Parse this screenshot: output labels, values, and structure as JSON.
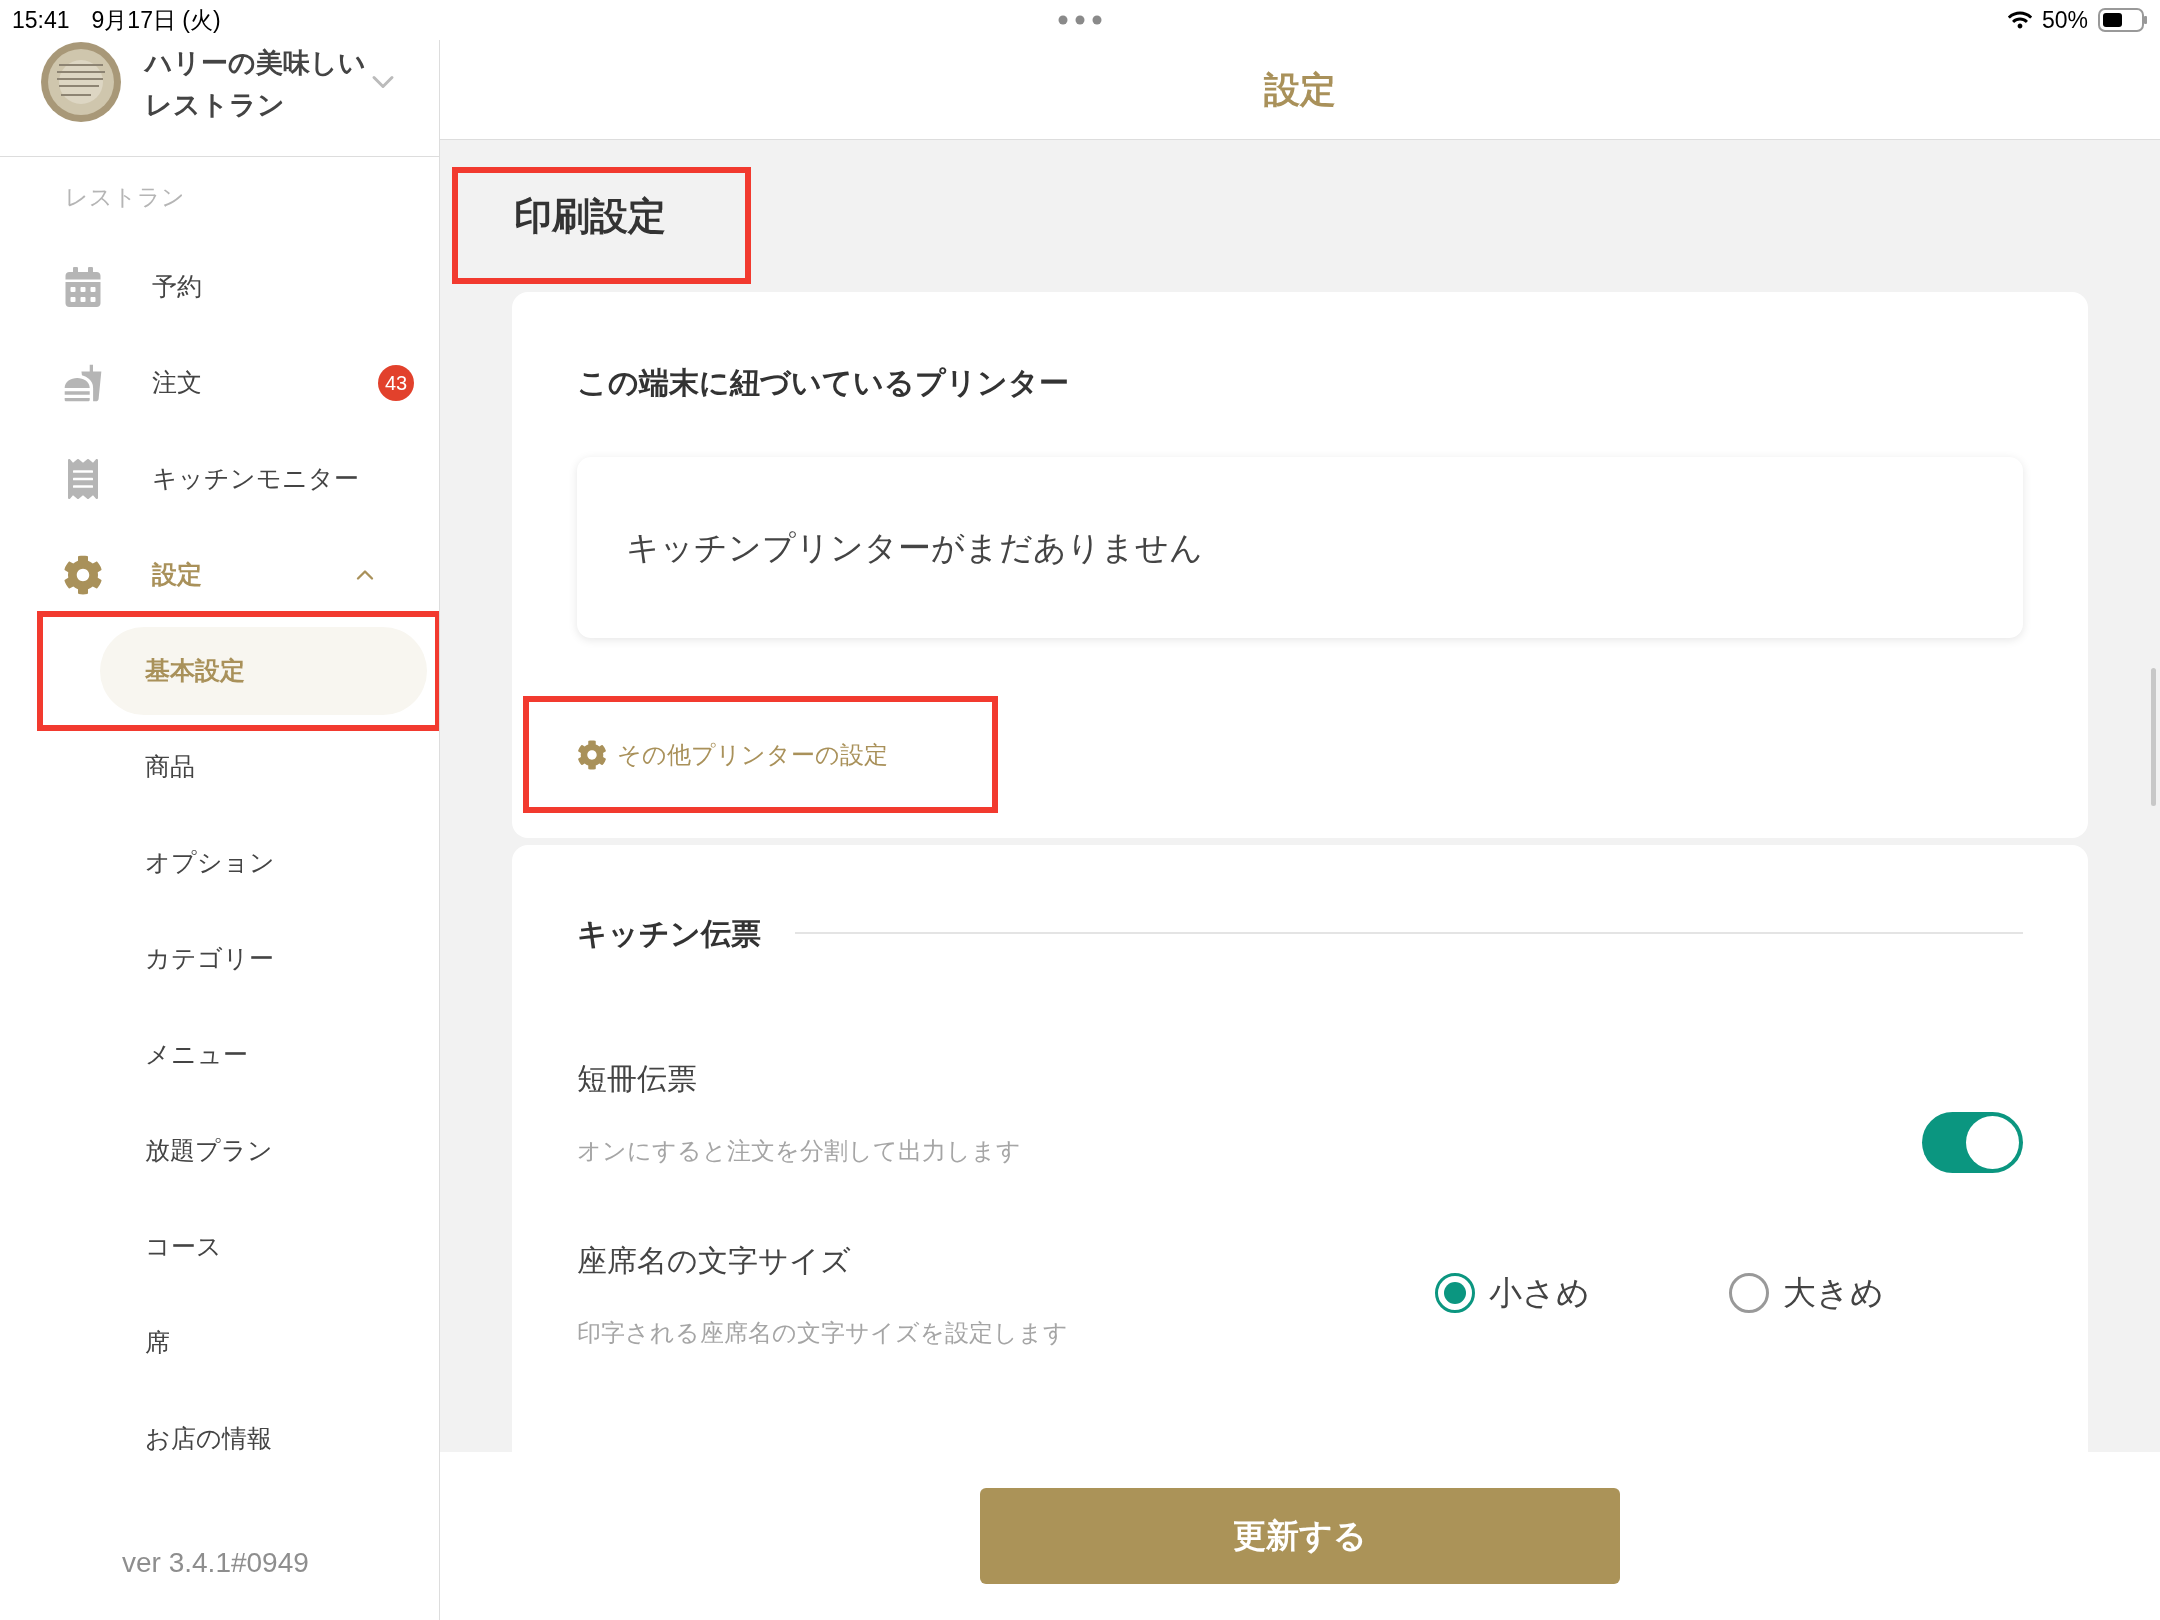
{
  "status_bar": {
    "time": "15:41",
    "date": "9月17日 (火)",
    "battery": "50%"
  },
  "restaurant": {
    "name": "ハリーの美味しいレストラン"
  },
  "sidebar": {
    "section": "レストラン",
    "items": [
      {
        "label": "予約",
        "kind": "calendar",
        "selected": false
      },
      {
        "label": "注文",
        "kind": "food",
        "badge": "43",
        "selected": false
      },
      {
        "label": "キッチンモニター",
        "kind": "receipt",
        "selected": false
      },
      {
        "label": "設定",
        "kind": "gear",
        "expanded": true,
        "selected": true,
        "children": [
          {
            "label": "基本設定",
            "selected": true,
            "highlighted": true
          },
          {
            "label": "商品",
            "selected": false,
            "highlighted": false
          },
          {
            "label": "オプション",
            "selected": false,
            "highlighted": false
          },
          {
            "label": "カテゴリー",
            "selected": false,
            "highlighted": false
          },
          {
            "label": "メニュー",
            "selected": false,
            "highlighted": false
          },
          {
            "label": "放題プラン",
            "selected": false,
            "highlighted": false
          },
          {
            "label": "コース",
            "selected": false,
            "highlighted": false
          },
          {
            "label": "席",
            "selected": false,
            "highlighted": false
          },
          {
            "label": "お店の情報",
            "selected": false,
            "highlighted": false
          }
        ]
      }
    ],
    "version": "ver 3.4.1#0949"
  },
  "header": {
    "title": "設定"
  },
  "section_title": {
    "text": "印刷設定",
    "highlighted": true
  },
  "printer_card": {
    "heading": "この端末に紐づいているプリンター",
    "empty_message": "キッチンプリンターがまだありません",
    "link": {
      "label": "その他プリンターの設定",
      "highlighted": true
    }
  },
  "kitchen_ticket": {
    "heading": "キッチン伝票",
    "settings": [
      {
        "kind": "toggle",
        "label": "短冊伝票",
        "description": "オンにすると注文を分割して出力します",
        "on": true
      },
      {
        "kind": "radio",
        "label": "座席名の文字サイズ",
        "description": "印字される座席名の文字サイズを設定します",
        "options": [
          {
            "label": "小さめ",
            "selected": true
          },
          {
            "label": "大きめ",
            "selected": false
          }
        ]
      }
    ]
  },
  "update_button": "更新する"
}
